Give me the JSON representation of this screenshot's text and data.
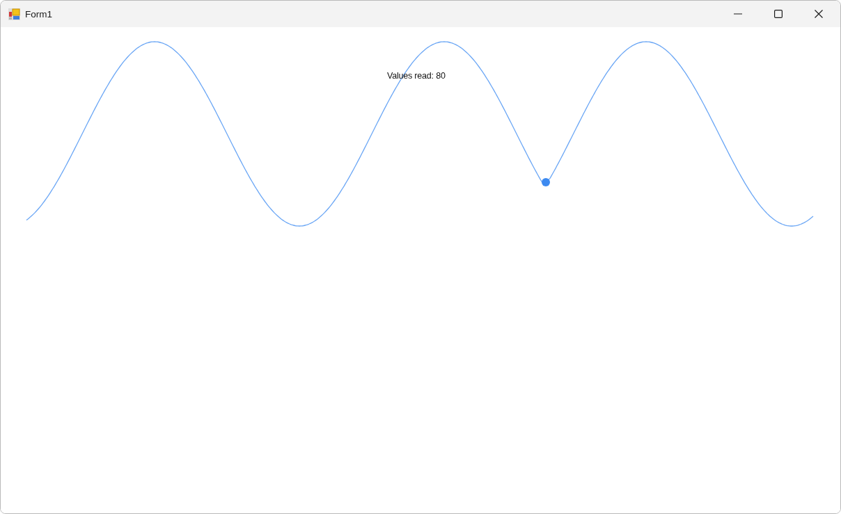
{
  "window": {
    "title": "Form1"
  },
  "canvas": {
    "readout": "Values read: 80"
  }
}
